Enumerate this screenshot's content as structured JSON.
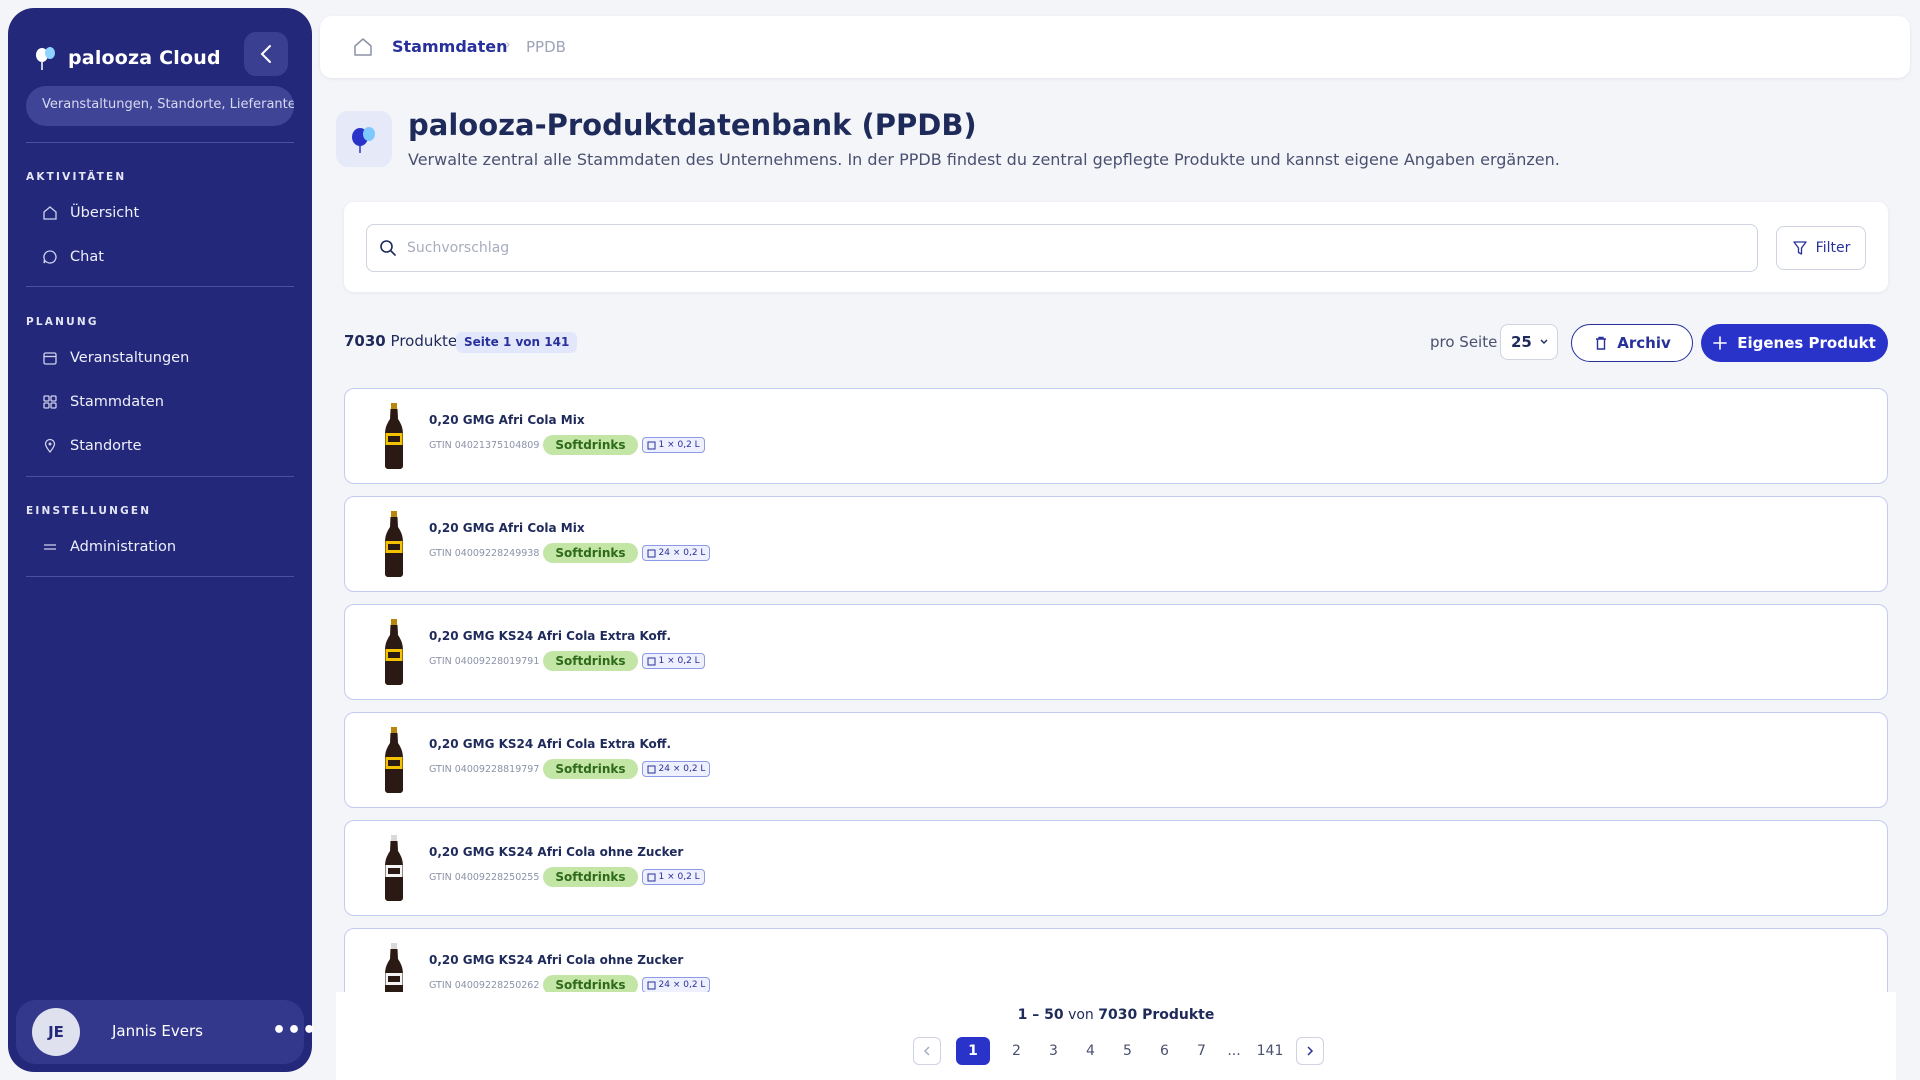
{
  "sidebar": {
    "brand": "palooza Cloud",
    "search_placeholder": "Veranstaltungen, Standorte, Lieferanten…",
    "sections": [
      {
        "label": "AKTIVITÄTEN",
        "items": [
          {
            "label": "Übersicht",
            "icon": "home-icon"
          },
          {
            "label": "Chat",
            "icon": "chat-icon"
          }
        ]
      },
      {
        "label": "PLANUNG",
        "items": [
          {
            "label": "Veranstaltungen",
            "icon": "calendar-icon"
          },
          {
            "label": "Stammdaten",
            "icon": "grid-icon"
          },
          {
            "label": "Standorte",
            "icon": "location-pin-icon"
          }
        ]
      },
      {
        "label": "EINSTELLUNGEN",
        "items": [
          {
            "label": "Administration",
            "icon": "settings-sliders-icon"
          }
        ]
      }
    ],
    "user": {
      "initials": "JE",
      "name": "Jannis Evers",
      "more": "•••"
    }
  },
  "breadcrumb": {
    "parent": "Stammdaten",
    "separator": "›",
    "current": "PPDB"
  },
  "header": {
    "title": "palooza-Produktdatenbank (PPDB)",
    "subtitle": "Verwalte zentral alle Stammdaten des Unternehmens. In der PPDB findest du zentral gepflegte Produkte und kannst eigene Angaben ergänzen."
  },
  "search": {
    "placeholder": "Suchvorschlag",
    "value": "",
    "filter_label": "Filter"
  },
  "toolbar": {
    "count_value": "7030",
    "count_label": "Produkte",
    "page_badge": "Seite 1 von 141",
    "per_page_label": "pro Seite",
    "per_page_value": "25",
    "archive_label": "Archiv",
    "add_label": "Eigenes Produkt"
  },
  "products": [
    {
      "name": "0,20 GMG Afri Cola Mix",
      "gtin": "GTIN 04021375104809",
      "category": "Softdrinks",
      "pack": "1 × 0,2 L"
    },
    {
      "name": "0,20 GMG Afri Cola Mix",
      "gtin": "GTIN 04009228249938",
      "category": "Softdrinks",
      "pack": "24 × 0,2 L"
    },
    {
      "name": "0,20 GMG KS24 Afri Cola Extra Koff.",
      "gtin": "GTIN 04009228019791",
      "category": "Softdrinks",
      "pack": "1 × 0,2 L"
    },
    {
      "name": "0,20 GMG KS24 Afri Cola Extra Koff.",
      "gtin": "GTIN 04009228819797",
      "category": "Softdrinks",
      "pack": "24 × 0,2 L"
    },
    {
      "name": "0,20 GMG KS24 Afri Cola ohne Zucker",
      "gtin": "GTIN 04009228250255",
      "category": "Softdrinks",
      "pack": "1 × 0,2 L"
    },
    {
      "name": "0,20 GMG KS24 Afri Cola ohne Zucker",
      "gtin": "GTIN 04009228250262",
      "category": "Softdrinks",
      "pack": "24 × 0,2 L"
    }
  ],
  "footer": {
    "range": "1 – 50",
    "range_of": "von",
    "total": "7030 Produkte",
    "pages": [
      "1",
      "2",
      "3",
      "4",
      "5",
      "6",
      "7"
    ],
    "ellipsis": "...",
    "last_page": "141"
  },
  "colors": {
    "sidebar_bg": "#24287a",
    "primary": "#2a33c9",
    "category_badge": "#c3e6a6",
    "card_border": "#c3cbf2"
  }
}
